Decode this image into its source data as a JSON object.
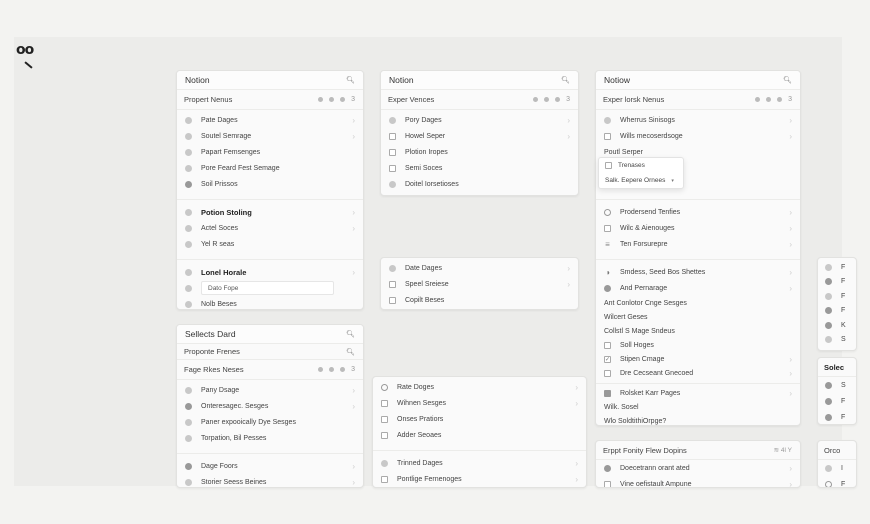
{
  "logo": "oo",
  "p1": {
    "title": "Notion",
    "sub": "Propert Nenus",
    "sub_suffix": "3",
    "rows1": [
      "Pate Dages",
      "Soutel Semrage",
      "Papart Femsenges",
      "Pore Feard Fest Semage",
      "Soil Prissos"
    ],
    "rows2_head": "Potion Stoling",
    "rows2": [
      "Actel Soces",
      "Yel R seas"
    ],
    "rows3_head": "Lonel Horale",
    "input_value": "Dato Fope",
    "rows3": [
      "Nolb Beses"
    ]
  },
  "p2": {
    "title": "Notion",
    "sub": "Exper Vences",
    "sub_suffix": "3",
    "rows": [
      "Pory Dages",
      "Howel Seper",
      "Plotion Iropes",
      "Semi Soces",
      "Doitel Iorsetioses"
    ]
  },
  "p2b": {
    "rows": [
      "Date Dages",
      "Speel Sreiese",
      "Copilt Beses"
    ]
  },
  "p3": {
    "title": "Notiow",
    "sub": "Exper lorsk Nenus",
    "sub_suffix": "3",
    "rows1": [
      "Wherrus Sinisogs",
      "Wills mecoserdsoge"
    ],
    "plain1": "Poutl Serper",
    "popover": [
      "Trenases",
      "Salk. Eepere Ornees"
    ],
    "rows2": [
      "Prodersend Tenfies",
      "Wilc & Aienouges",
      "Ten Forsurepre"
    ],
    "rows3": [
      "Smdess, Seed Bos Shettes",
      "And Pernarage"
    ],
    "plain2": [
      "Ant Conlotor Cnge Sesges",
      "Wilcert Geses",
      "Collstl S Mage Sndeus"
    ],
    "rows4": [
      "Soll Hoges",
      "Stipen Cmage",
      "Dre Cecseant Gnecoed"
    ],
    "rows5_head": "Rolsket Karr Pages",
    "plain3": [
      "Wilk. Sosel",
      "Wlo SoldtithiOrpge?"
    ]
  },
  "p4": {
    "title": "Sellects Dard",
    "search": "Proponte Frenes",
    "sub": "Fage Rkes Neses",
    "sub_suffix": "3",
    "rows": [
      "Pany Dsage",
      "Onteresagec. Sesges",
      "Paner expooically Dye Sesges",
      "Torpation, Bil Pesses"
    ],
    "bottom": [
      "Dage Foors",
      "Storier Seess Beines"
    ]
  },
  "p5": {
    "rows": [
      "Rate Doges",
      "Wihnen Sesges",
      "Onses Pratiors",
      "Adder Seoaes"
    ],
    "bottom": [
      "Trinned Dages",
      "Pontlige Fernenoges"
    ]
  },
  "p6": {
    "title": "Erppt Fonity Flew Dopins",
    "title_suffix": "≋ 4l Y",
    "rows": [
      "Doecetrann orant ated",
      "Vine oefistault Ampune"
    ]
  },
  "p7": {
    "labels": [
      "F",
      "F",
      "F",
      "F",
      "K",
      "S"
    ],
    "title": "Solec",
    "rows": [
      "S",
      "F",
      "F"
    ],
    "bottom_title": "Orco",
    "bottom_rows": [
      "I",
      "F"
    ]
  }
}
